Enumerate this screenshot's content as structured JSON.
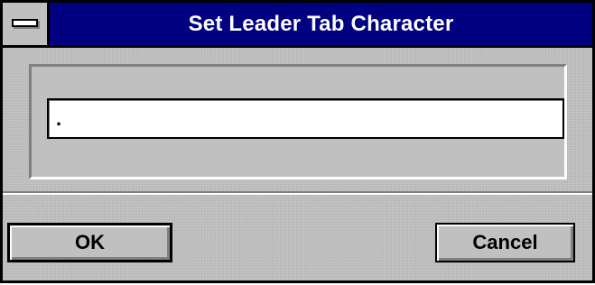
{
  "window": {
    "title": "Set Leader Tab Character"
  },
  "dialog": {
    "leader_char_value": ".",
    "ok_label": "OK",
    "cancel_label": "Cancel"
  },
  "icons": {
    "system_menu": "system-menu-icon"
  },
  "colors": {
    "title_bar": "#000080",
    "face": "#c0c0c0",
    "field": "#ffffff",
    "title_text": "#ffffff"
  }
}
